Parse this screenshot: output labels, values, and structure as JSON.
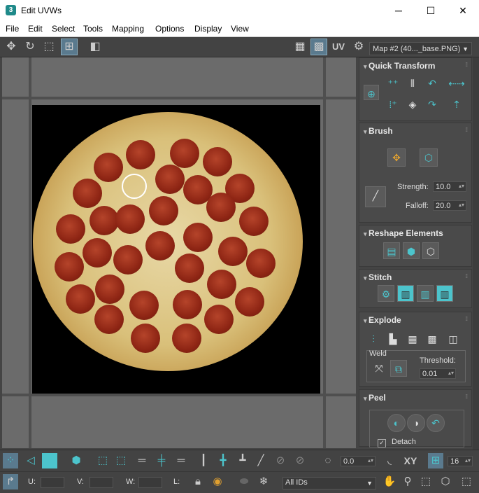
{
  "window": {
    "title": "Edit UVWs",
    "app_icon": "3"
  },
  "menu": [
    "File",
    "Edit",
    "Select",
    "Tools",
    "Mapping",
    "Options",
    "Display",
    "View"
  ],
  "toolbar": {
    "uv_label": "UV",
    "map_select": "Map #2 (40..._base.PNG)"
  },
  "panels": {
    "quick_transform": {
      "title": "Quick Transform"
    },
    "brush": {
      "title": "Brush",
      "strength_label": "Strength:",
      "strength_value": "10.0",
      "falloff_label": "Falloff:",
      "falloff_value": "20.0"
    },
    "reshape": {
      "title": "Reshape Elements"
    },
    "stitch": {
      "title": "Stitch"
    },
    "explode": {
      "title": "Explode",
      "weld_label": "Weld",
      "threshold_label": "Threshold:",
      "threshold_value": "0.01"
    },
    "peel": {
      "title": "Peel",
      "detach_label": "Detach",
      "detach_checked": true
    }
  },
  "bottom": {
    "angle_value": "0.0",
    "xy_label": "XY",
    "grid_value": "16",
    "u_label": "U:",
    "v_label": "V:",
    "w_label": "W:",
    "l_label": "L:",
    "ids_select": "All IDs"
  },
  "colors": {
    "accent": "#4cc4cc",
    "panel_bg": "#4a4a4a",
    "viewport_bg": "#6b6b6b"
  }
}
